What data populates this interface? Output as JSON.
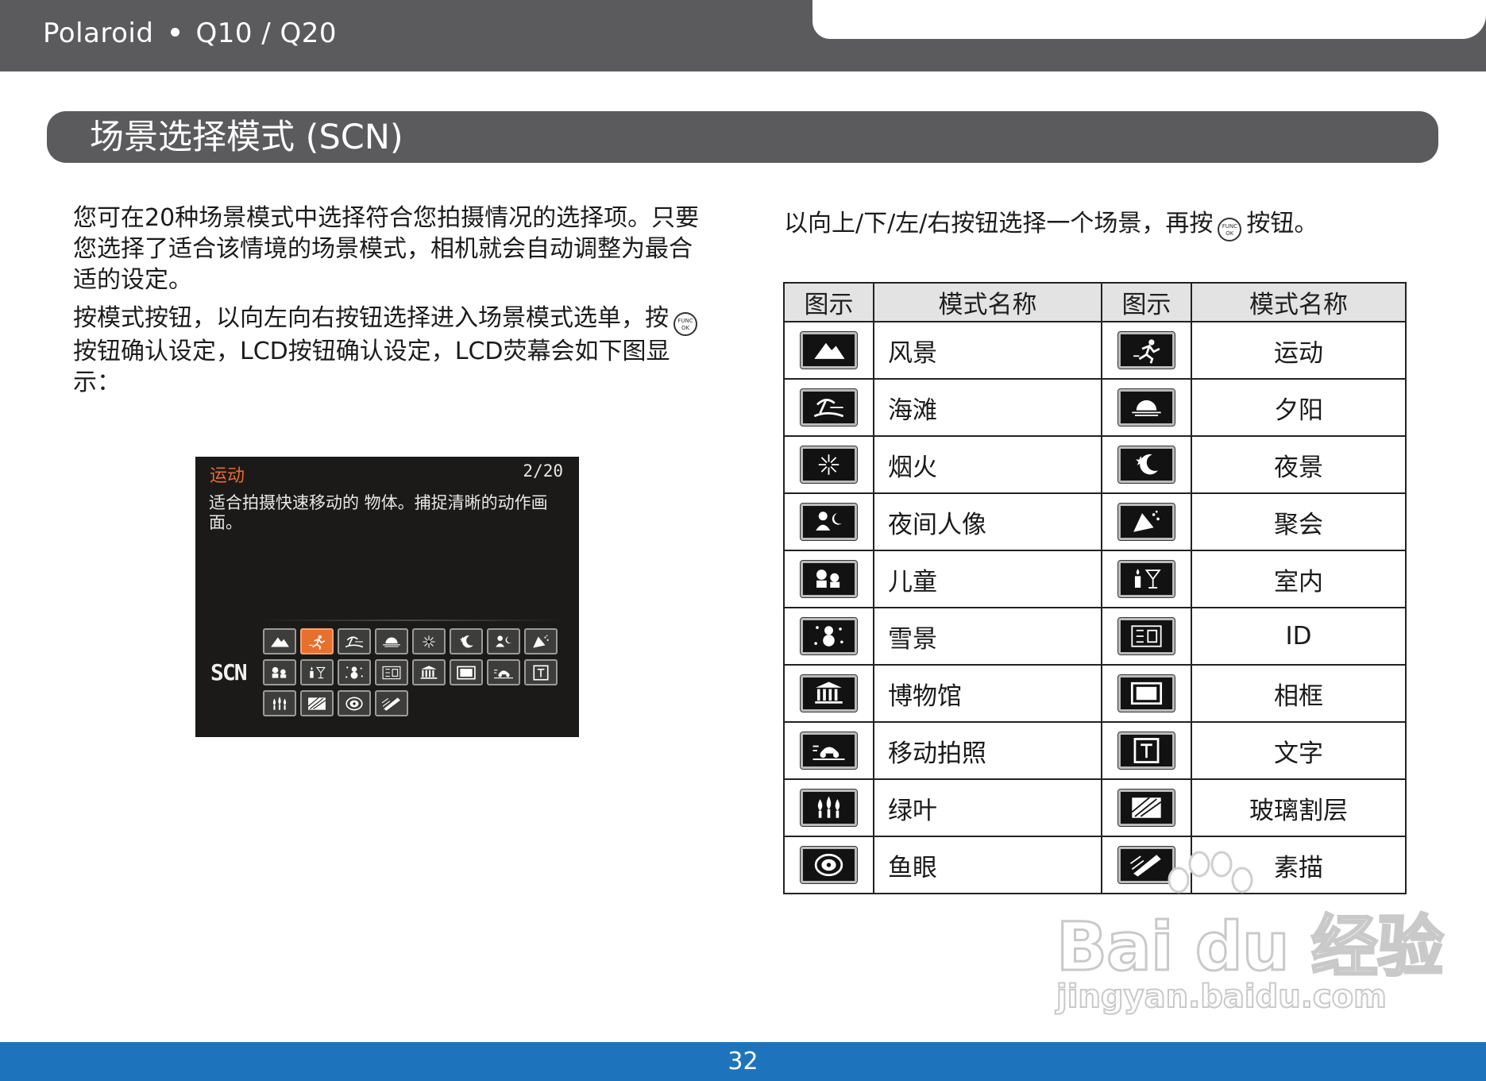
{
  "header": {
    "brand": "Polaroid",
    "model": "Q10 / Q20"
  },
  "section": {
    "title": "场景选择模式 (SCN)"
  },
  "left_text": {
    "p1": "您可在20种场景模式中选择符合您拍摄情况的选择项。只要您选择了适合该情境的场景模式，相机就会自动调整为最合适的设定。",
    "p2_a": "按模式按钮，以向左向右按钮选择进入场景模式选单，按",
    "p2_b": "按钮确认设定，LCD按钮确认设定，LCD荧幕会如下图显示："
  },
  "right_text": {
    "a": "以向上/下/左/右按钮选择一个场景，再按",
    "b": "按钮。"
  },
  "func_button": {
    "top": "FUNC",
    "bottom": "OK"
  },
  "lcd": {
    "title": "运动",
    "page": "2/20",
    "description": "适合拍摄快速移动的 物体。捕捉清晰的动作画面。",
    "scn_label": "SCN",
    "icons": [
      "landscape-icon",
      "sport-icon",
      "beach-icon",
      "sunset-icon",
      "fireworks-icon",
      "night-scene-icon",
      "night-portrait-icon",
      "party-icon",
      "kids-icon",
      "indoor-icon",
      "snow-icon",
      "id-icon",
      "museum-icon",
      "frame-icon",
      "panning-icon",
      "text-icon",
      "foliage-icon",
      "glass-icon",
      "fisheye-icon",
      "sketch-icon"
    ],
    "selected_index": 1,
    "accent_color": "#e8702e"
  },
  "table": {
    "headers": [
      "图示",
      "模式名称",
      "图示",
      "模式名称"
    ],
    "rows": [
      {
        "left_icon": "landscape-icon",
        "left_name": "风景",
        "right_icon": "sport-icon",
        "right_name": "运动"
      },
      {
        "left_icon": "beach-icon",
        "left_name": "海滩",
        "right_icon": "sunset-icon",
        "right_name": "夕阳"
      },
      {
        "left_icon": "fireworks-icon",
        "left_name": "烟火",
        "right_icon": "night-scene-icon",
        "right_name": "夜景"
      },
      {
        "left_icon": "night-portrait-icon",
        "left_name": "夜间人像",
        "right_icon": "party-icon",
        "right_name": "聚会"
      },
      {
        "left_icon": "kids-icon",
        "left_name": "儿童",
        "right_icon": "indoor-icon",
        "right_name": "室内"
      },
      {
        "left_icon": "snow-icon",
        "left_name": "雪景",
        "right_icon": "id-icon",
        "right_name": "ID"
      },
      {
        "left_icon": "museum-icon",
        "left_name": "博物馆",
        "right_icon": "frame-icon",
        "right_name": "相框"
      },
      {
        "left_icon": "panning-icon",
        "left_name": "移动拍照",
        "right_icon": "text-icon",
        "right_name": "文字"
      },
      {
        "left_icon": "foliage-icon",
        "left_name": "绿叶",
        "right_icon": "glass-icon",
        "right_name": "玻璃割层"
      },
      {
        "left_icon": "fisheye-icon",
        "left_name": "鱼眼",
        "right_icon": "sketch-icon",
        "right_name": "素描"
      }
    ]
  },
  "watermark": {
    "logo": "Bai du 经验",
    "url": "jingyan.baidu.com"
  },
  "footer": {
    "page": "32",
    "color": "#1d74bd"
  }
}
